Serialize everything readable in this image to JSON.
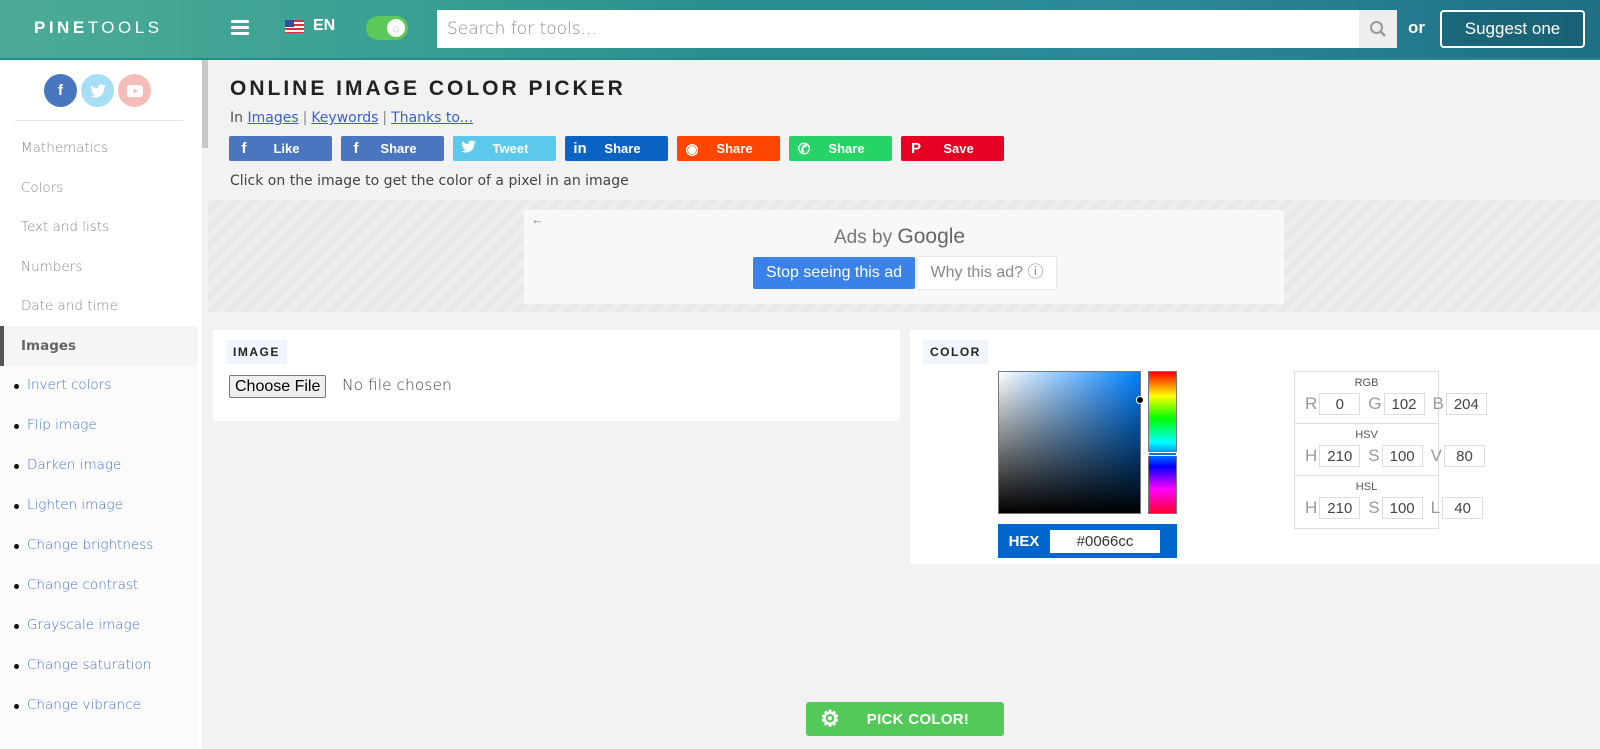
{
  "header": {
    "logo_bold": "PINE",
    "logo_light": "TOOLS",
    "language": "EN",
    "search_placeholder": "Search for tools...",
    "or_text": "or",
    "suggest_label": "Suggest one"
  },
  "sidebar": {
    "social": [
      {
        "name": "facebook",
        "glyph": "f",
        "color": "#4a76c0"
      },
      {
        "name": "twitter",
        "glyph": "t",
        "color": "#a6def5"
      },
      {
        "name": "youtube",
        "glyph": "▶",
        "color": "#f5bdb8"
      }
    ],
    "categories": [
      {
        "label": "Mathematics",
        "active": false
      },
      {
        "label": "Colors",
        "active": false
      },
      {
        "label": "Text and lists",
        "active": false
      },
      {
        "label": "Numbers",
        "active": false
      },
      {
        "label": "Date and time",
        "active": false
      },
      {
        "label": "Images",
        "active": true
      }
    ],
    "image_tools": [
      "Invert colors",
      "Flip image",
      "Darken image",
      "Lighten image",
      "Change brightness",
      "Change contrast",
      "Grayscale image",
      "Change saturation",
      "Change vibrance"
    ]
  },
  "main": {
    "title": "ONLINE IMAGE COLOR PICKER",
    "breadcrumb_prefix": "In",
    "breadcrumb_links": [
      "Images",
      "Keywords",
      "Thanks to..."
    ],
    "share_buttons": [
      {
        "network": "facebook",
        "icon": "f",
        "label": "Like",
        "color": "#4a76c0"
      },
      {
        "network": "facebook",
        "icon": "f",
        "label": "Share",
        "color": "#4a76c0"
      },
      {
        "network": "twitter",
        "icon": "🐦",
        "label": "Tweet",
        "color": "#5bc8ec"
      },
      {
        "network": "linkedin",
        "icon": "in",
        "label": "Share",
        "color": "#0a62c2"
      },
      {
        "network": "reddit",
        "icon": "◉",
        "label": "Share",
        "color": "#ff4500"
      },
      {
        "network": "whatsapp",
        "icon": "✆",
        "label": "Share",
        "color": "#25d366"
      },
      {
        "network": "pinterest",
        "icon": "P",
        "label": "Save",
        "color": "#e60023"
      }
    ],
    "description": "Click on the image to get the color of a pixel in an image"
  },
  "ad": {
    "back_icon": "←",
    "ads_by": "Ads by",
    "brand": "Google",
    "stop_label": "Stop seeing this ad",
    "why_label": "Why this ad? ⓘ"
  },
  "image_panel": {
    "label": "IMAGE",
    "choose_file_label": "Choose File",
    "file_status": "No file chosen"
  },
  "color_panel": {
    "label": "COLOR",
    "hex_label": "HEX",
    "hex_value": "#0066cc",
    "rgb": {
      "title": "RGB",
      "r": "0",
      "g": "102",
      "b": "204"
    },
    "hsv": {
      "title": "HSV",
      "h": "210",
      "s": "100",
      "v": "80"
    },
    "hsl": {
      "title": "HSL",
      "h": "210",
      "s": "100",
      "l": "40"
    },
    "hue_degrees": 210,
    "saturation_pct": 100,
    "value_pct": 80
  },
  "pick_button": {
    "label": "PICK COLOR!"
  }
}
